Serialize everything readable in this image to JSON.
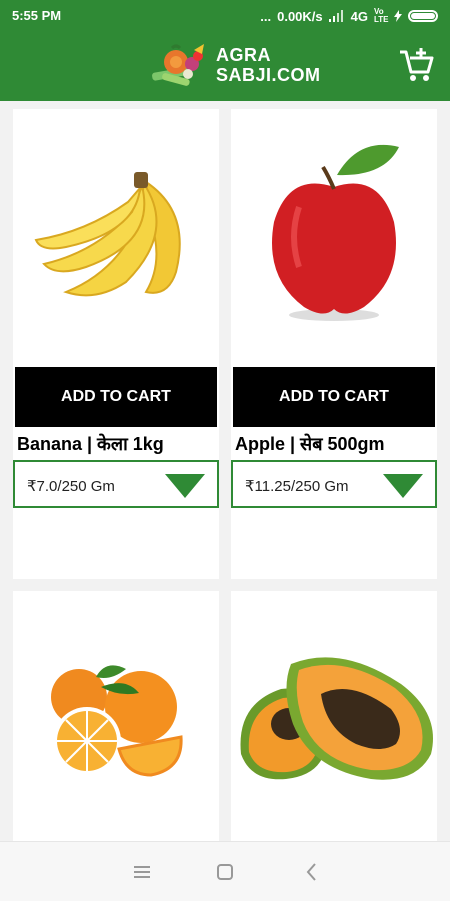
{
  "status_bar": {
    "time": "5:55 PM",
    "dots": "...",
    "network_speed": "0.00K/s",
    "network_type": "4G",
    "volte": "Vo LTE"
  },
  "app_bar": {
    "logo_line1": "AGRA",
    "logo_line2": "SABJI.COM",
    "cart_icon": "add-shopping-cart-icon"
  },
  "colors": {
    "primary": "#2f8a35",
    "button": "#000000"
  },
  "products": [
    {
      "name": "Banana | केला 1kg",
      "button_label": "ADD TO CART",
      "selected_option": "₹7.0/250 Gm",
      "image": "banana"
    },
    {
      "name": "Apple | सेब 500gm",
      "button_label": "ADD TO CART",
      "selected_option": "₹11.25/250 Gm",
      "image": "apple"
    },
    {
      "name": "",
      "button_label": "",
      "selected_option": "",
      "image": "oranges"
    },
    {
      "name": "",
      "button_label": "",
      "selected_option": "",
      "image": "papaya"
    }
  ],
  "nav_bar": {
    "icons": [
      "menu-icon",
      "home-square-icon",
      "back-icon"
    ]
  }
}
